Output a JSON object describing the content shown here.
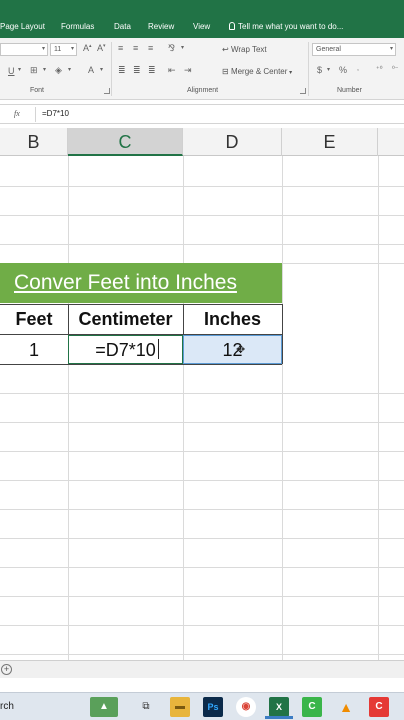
{
  "ribbon_tabs": [
    "Page Layout",
    "Formulas",
    "Data",
    "Review",
    "View"
  ],
  "tell_me": "Tell me what you want to do...",
  "font": {
    "name": "",
    "size": "11",
    "group_label": "Font"
  },
  "alignment": {
    "wrap_text": "Wrap Text",
    "merge_center": "Merge & Center",
    "group_label": "Alignment"
  },
  "number": {
    "format": "General",
    "currency": "$",
    "percent": "%",
    "group_label": "Number"
  },
  "formula_bar": {
    "fx": "fx",
    "formula": "=D7*10"
  },
  "columns": [
    "B",
    "C",
    "D",
    "E"
  ],
  "sheet": {
    "title": "Conver Feet into Inches",
    "headers": [
      "Feet",
      "Centimeter",
      "Inches"
    ],
    "row": [
      "1",
      "=D7*10",
      "12"
    ]
  },
  "taskbar": {
    "search_partial": "rch",
    "apps": [
      "task-view",
      "file-explorer",
      "photoshop",
      "chrome",
      "excel",
      "camtasia",
      "vlc",
      "camtasia-recorder"
    ]
  },
  "colors": {
    "excel_green": "#217346",
    "title_band": "#70ad47",
    "selection_blue": "#dbe8f7"
  }
}
